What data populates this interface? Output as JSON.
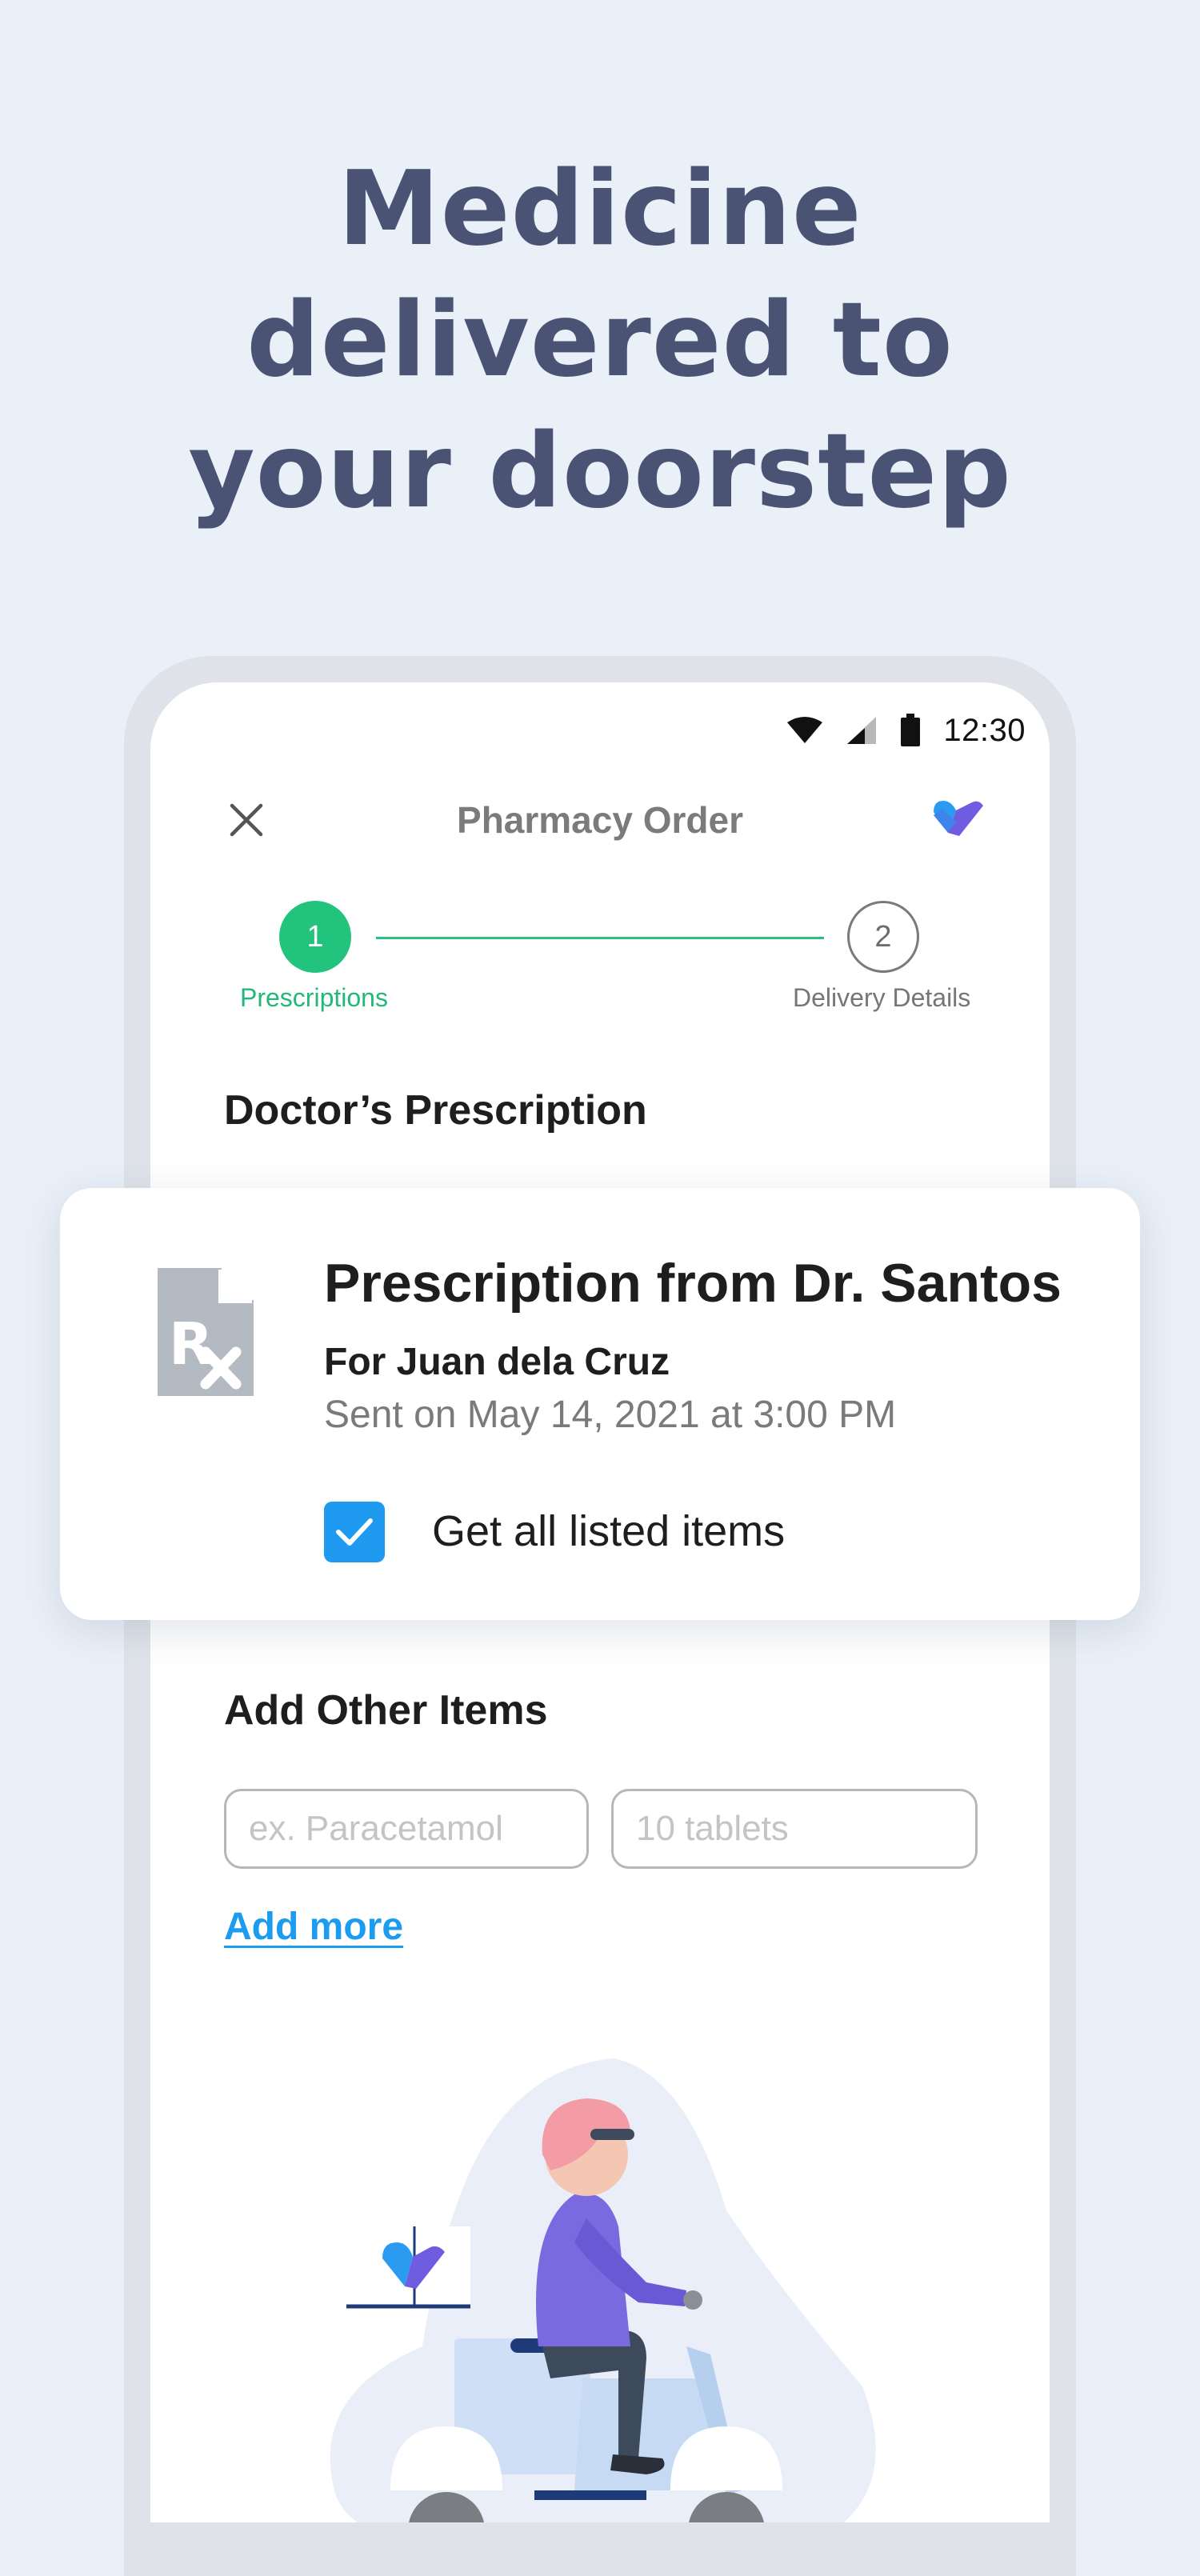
{
  "headline": {
    "lines": [
      "Medicine",
      "delivered to",
      "your doorstep"
    ]
  },
  "status_bar": {
    "time": "12:30",
    "icons": [
      "wifi-icon",
      "signal-icon",
      "battery-icon"
    ]
  },
  "app_bar": {
    "title": "Pharmacy Order",
    "close_icon": "close-icon",
    "logo_icon": "heart-check-logo"
  },
  "stepper": {
    "steps": [
      {
        "number": "1",
        "label": "Prescriptions",
        "state": "active"
      },
      {
        "number": "2",
        "label": "Delivery Details",
        "state": "inactive"
      }
    ]
  },
  "prescription_section": {
    "title": "Doctor’s Prescription"
  },
  "prescription_card": {
    "icon": "prescription-document-icon",
    "title": "Prescription from Dr. Santos",
    "patient": "For Juan dela Cruz",
    "sent": "Sent on May 14, 2021 at 3:00 PM",
    "checkbox_label": "Get all listed items",
    "checked": true
  },
  "other_items": {
    "title": "Add Other Items",
    "medicine_placeholder": "ex. Paracetamol",
    "quantity_placeholder": "10 tablets",
    "add_more_label": "Add more"
  },
  "colors": {
    "background": "#eaf0f8",
    "headline": "#4b5375",
    "accent_green": "#22c47d",
    "accent_blue": "#1e9bf0",
    "logo_purple": "#7a63e0"
  }
}
